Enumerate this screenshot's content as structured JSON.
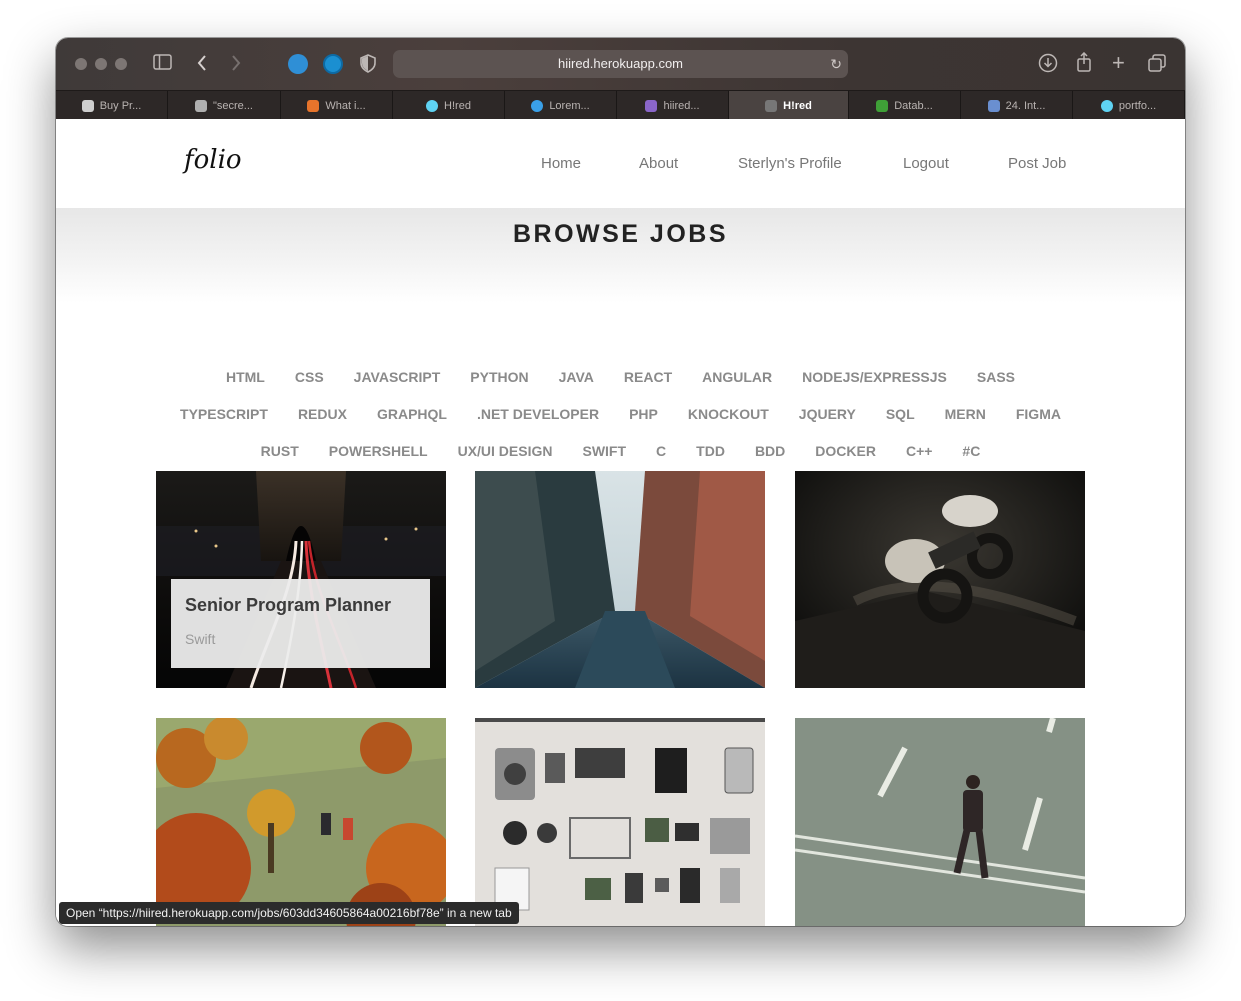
{
  "browser": {
    "url": "hiired.herokuapp.com",
    "status_text": "Open “https://hiired.herokuapp.com/jobs/603dd34605864a00216bf78e” in a new tab",
    "tabs": [
      {
        "label": "Buy Pr...",
        "icon": "apple-icon",
        "color": "#cfcfcf"
      },
      {
        "label": "\"secre...",
        "icon": "chat-icon",
        "color": "#b0b0b0"
      },
      {
        "label": "What i...",
        "icon": "stackoverflow-icon",
        "color": "#e8742b"
      },
      {
        "label": "H!red",
        "icon": "react-icon",
        "color": "#5fd3f3"
      },
      {
        "label": "Lorem...",
        "icon": "globe-icon",
        "color": "#3aa0e8"
      },
      {
        "label": "hiired...",
        "icon": "heroku-icon",
        "color": "#8a66c9"
      },
      {
        "label": "H!red",
        "icon": "h-icon",
        "color": "#777777",
        "active": true
      },
      {
        "label": "Datab...",
        "icon": "mongodb-icon",
        "color": "#3fa037"
      },
      {
        "label": "24. Int...",
        "icon": "cloud-icon",
        "color": "#6a8fd0"
      },
      {
        "label": "portfo...",
        "icon": "react-icon",
        "color": "#5fd3f3"
      }
    ]
  },
  "site": {
    "logo": "folio",
    "nav": [
      "Home",
      "About",
      "Sterlyn's Profile",
      "Logout",
      "Post Job"
    ]
  },
  "hero": {
    "title": "BROWSE JOBS"
  },
  "tags": {
    "row1": [
      "HTML",
      "CSS",
      "JAVASCRIPT",
      "PYTHON",
      "JAVA",
      "REACT",
      "ANGULAR",
      "NODEJS/EXPRESSJS",
      "SASS"
    ],
    "row2": [
      "TYPESCRIPT",
      "REDUX",
      "GRAPHQL",
      ".NET DEVELOPER",
      "PHP",
      "KNOCKOUT",
      "JQUERY",
      "SQL",
      "MERN",
      "FIGMA"
    ],
    "row3": [
      "RUST",
      "POWERSHELL",
      "UX/UI DESIGN",
      "SWIFT",
      "C",
      "TDD",
      "BDD",
      "DOCKER",
      "C++",
      "#C"
    ]
  },
  "jobs": [
    {
      "title": "Senior Program Planner",
      "skill": "Swift",
      "image": "bridge-night-light-trails"
    },
    {
      "image": "city-street"
    },
    {
      "image": "atv-rider"
    },
    {
      "image": "autumn-hikers"
    },
    {
      "image": "camera-parts-flatlay"
    },
    {
      "image": "man-crossing-road"
    }
  ]
}
